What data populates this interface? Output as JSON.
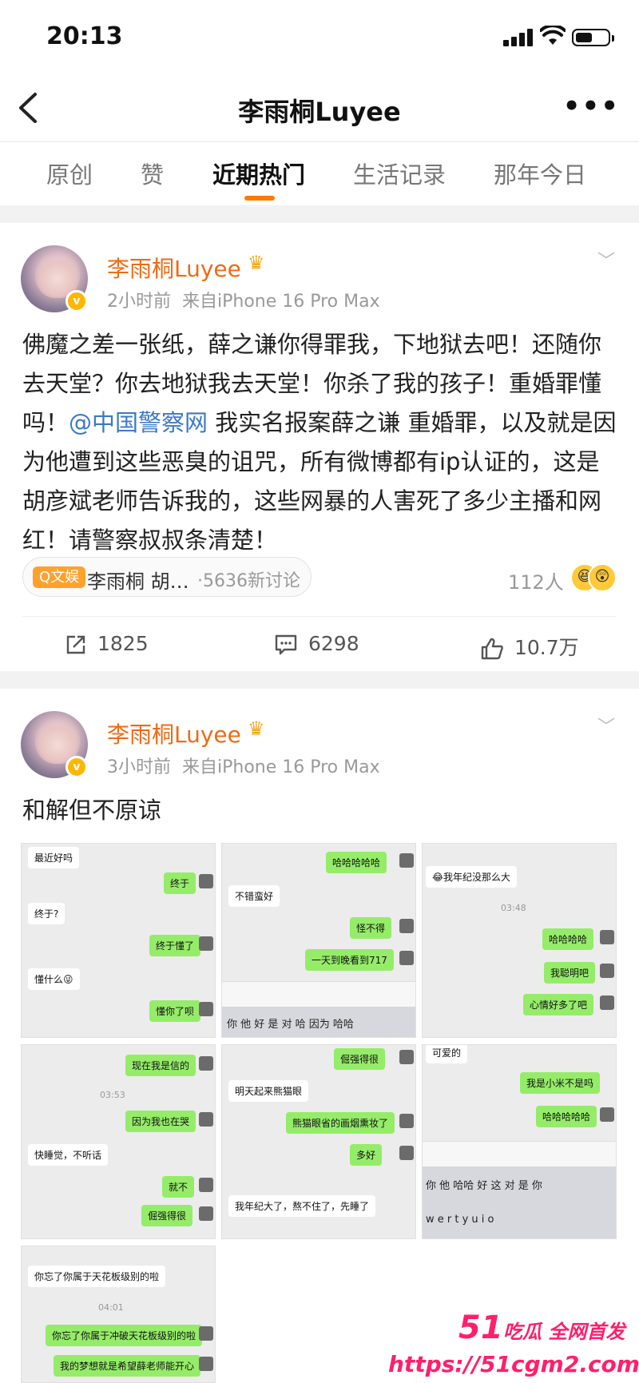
{
  "status_bar": {
    "time": "20:13"
  },
  "header": {
    "title": "李雨桐Luyee"
  },
  "tabs": [
    {
      "label": "原创"
    },
    {
      "label": "赞"
    },
    {
      "label": "近期热门"
    },
    {
      "label": "生活记录"
    },
    {
      "label": "那年今日"
    }
  ],
  "active_tab": "近期热门",
  "posts": [
    {
      "author": "李雨桐Luyee",
      "time": "2小时前",
      "source": "来自iPhone 16 Pro Max",
      "text_before_mention": "佛魔之差一张纸，薛之谦你得罪我，下地狱去吧！还随你去天堂？你去地狱我去天堂！你杀了我的孩子！重婚罪懂吗！",
      "mention": "@中国警察网",
      "text_after_mention": " 我实名报案薛之谦 重婚罪，以及就是因为他遭到这些恶臭的诅咒，所有微博都有ip认证的，这是胡彦斌老师告诉我的，这些网暴的人害死了多少主播和网红！请警察叔叔条清楚！",
      "topic_tag": "Q文娱",
      "topic_name": "李雨桐 胡…",
      "topic_count": "·5636新讨论",
      "people": "112人",
      "repost_count": "1825",
      "comment_count": "6298",
      "like_count": "10.7万"
    },
    {
      "author": "李雨桐Luyee",
      "time": "3小时前",
      "source": "来自iPhone 16 Pro Max",
      "text": "和解但不原谅"
    }
  ],
  "chat_screenshots": {
    "s1": {
      "a": "最近好吗",
      "b": "终于",
      "c": "终于?",
      "d": "终于懂了",
      "e": "懂什么😜",
      "f": "懂你了呗"
    },
    "s2": {
      "a": "哈哈哈哈哈",
      "b": "不错蛮好",
      "c": "怪不得",
      "d": "一天到晚看到717",
      "keyboard": "你  他  好  是  对  哈  因为  哈哈"
    },
    "s3": {
      "a": "😂我年纪没那么大",
      "time": "03:48",
      "b": "哈哈哈哈",
      "c": "我聪明吧",
      "d": "心情好多了吧"
    },
    "s4": {
      "a": "现在我是信的",
      "time": "03:53",
      "b": "因为我也在哭",
      "c": "快睡觉，不听话",
      "d": "就不",
      "e": "倔强得很"
    },
    "s5": {
      "a": "倔强得很",
      "b": "明天起来熊猫眼",
      "c": "熊猫眼省的画烟熏妆了",
      "d": "多好",
      "e": "我年纪大了，熬不住了，先睡了"
    },
    "s6": {
      "a": "可爱的",
      "b": "我是小米不是吗",
      "c": "哈哈哈哈哈",
      "kb1": "你  他  哈哈  好  这  对  是  你",
      "kb2": "w  e  r  t  y  u  i  o"
    },
    "s7": {
      "a": "你忘了你属于天花板级别的啦",
      "time": "04:01",
      "b": "你忘了你属于冲破天花板级别的啦",
      "c": "我的梦想就是希望薛老师能开心"
    }
  },
  "watermark": {
    "logo": "51",
    "tagline": "吃瓜 全网首发",
    "url": "https://51cgm2.com"
  },
  "colors": {
    "accent": "#ff7a00",
    "username": "#f06a14",
    "mention": "#3c78c8",
    "chat_me": "#95ec69",
    "watermark": "#ff1f6b"
  }
}
